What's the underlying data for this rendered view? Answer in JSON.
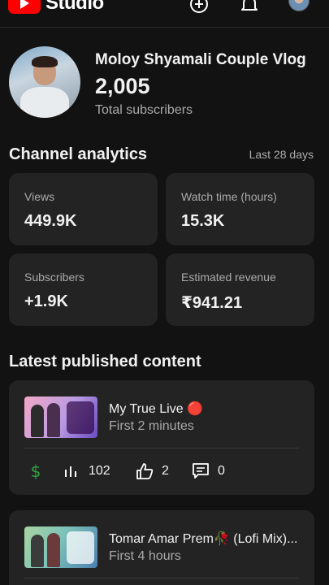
{
  "header": {
    "logo_text": "Studio",
    "icons": [
      "create-icon",
      "notifications-icon",
      "account-avatar"
    ]
  },
  "channel": {
    "name": "Moloy Shyamali Couple Vlog",
    "subscriber_count": "2,005",
    "subscriber_label": "Total subscribers"
  },
  "analytics": {
    "title": "Channel analytics",
    "period": "Last 28 days",
    "stats": [
      {
        "label": "Views",
        "value": "449.9K"
      },
      {
        "label": "Watch time (hours)",
        "value": "15.3K"
      },
      {
        "label": "Subscribers",
        "value": "+1.9K"
      },
      {
        "label": "Estimated revenue",
        "value": "₹941.21"
      }
    ]
  },
  "latest": {
    "title": "Latest published content",
    "items": [
      {
        "title": "My True Live 🔴",
        "age": "First 2 minutes",
        "views": "102",
        "likes": "2",
        "comments": "0"
      },
      {
        "title": "Tomar Amar Prem🥀 (Lofi Mix)...",
        "age": "First 4 hours"
      }
    ]
  },
  "colors": {
    "background": "#121212",
    "card": "#232323",
    "brand_red": "#ff0000",
    "revenue_green": "#2ba640",
    "secondary_text": "#aaaaaa"
  }
}
